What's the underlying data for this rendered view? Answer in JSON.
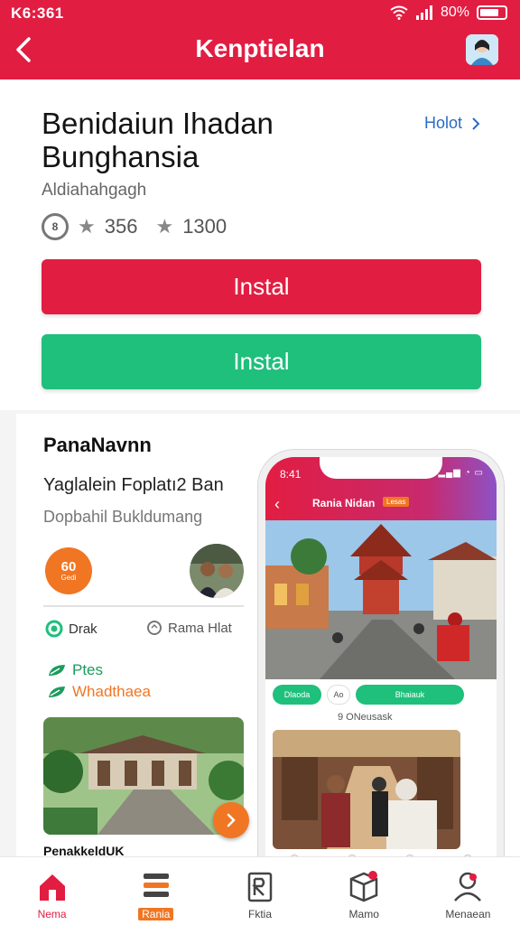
{
  "status_bar": {
    "time": "K6:361",
    "battery_text": "80%",
    "battery_level": 0.8
  },
  "header": {
    "title": "Kenptielan"
  },
  "app": {
    "title": "Benidaiun Ihadan Bunghansia",
    "more_link": "Holot",
    "developer": "Aldiahahgagh",
    "rating_badge": "8",
    "rating_1": "356",
    "rating_2": "1300",
    "install_primary": "Instal",
    "install_secondary": "Instal"
  },
  "promo": {
    "title": "PanaNavnn",
    "subtitle": "Yaglalein Foplatı2 Ban",
    "caption": "Dopbahil Bukldumang",
    "score_value": "60",
    "score_label": "Gedi",
    "option_1": "Drak",
    "option_2": "Rama Hlat",
    "feature_1": "Ptes",
    "feature_2": "Whadthaea",
    "photo_caption": "PenakkeldUK"
  },
  "phone": {
    "time": "8:41",
    "title": "Rania Nidan",
    "badge": "Lesas",
    "chip_1": "Dlaoda",
    "chip_2": "Ao",
    "chip_3": "Bhaiauk",
    "subtitle": "9 ONeusask"
  },
  "bottom_nav": {
    "items": [
      {
        "label": "Nema"
      },
      {
        "label": "Rania"
      },
      {
        "label": "Fktia"
      },
      {
        "label": "Mamo"
      },
      {
        "label": "Menaean"
      }
    ]
  },
  "colors": {
    "brand_red": "#e21d42",
    "brand_green": "#1fbf7c",
    "accent_orange": "#f07623",
    "link_blue": "#2b6cc4"
  }
}
